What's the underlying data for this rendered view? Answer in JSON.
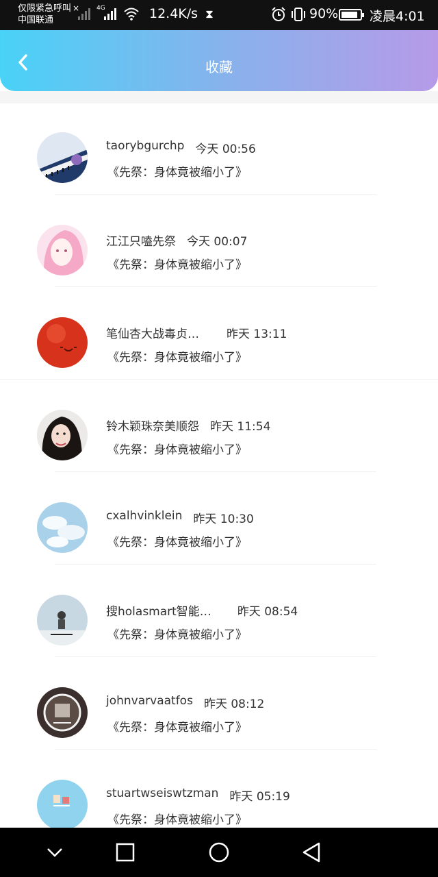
{
  "status_bar": {
    "line1": "仅限紧急呼叫",
    "carrier_x": "×",
    "line2": "中国联通",
    "network": "4G",
    "net_speed": "12.4K/s",
    "battery_percent": "90%",
    "battery_level": 0.9,
    "time": "凌晨4:01"
  },
  "header": {
    "title": "收藏",
    "colors": {
      "start": "#49d2f7",
      "end": "#b69ae8"
    }
  },
  "favorites": [
    {
      "name": "taorybgurchp",
      "time": "今天  00:56",
      "work": "《先祭：身体竟被缩小了》",
      "avatar": "piano-photo"
    },
    {
      "name": "江江只嗑先祭",
      "time": "今天  00:07",
      "work": "《先祭：身体竟被缩小了》",
      "avatar": "anime-girl-pink"
    },
    {
      "name": "笔仙杏大战毒贞…",
      "time": "昨天  13:11",
      "work": "《先祭：身体竟被缩小了》",
      "avatar": "red-tomato-face"
    },
    {
      "name": "铃木颖珠奈美顺怨",
      "time": "昨天  11:54",
      "work": "《先祭：身体竟被缩小了》",
      "avatar": "woman-portrait"
    },
    {
      "name": "cxalhvinklein",
      "time": "昨天  10:30",
      "work": "《先祭：身体竟被缩小了》",
      "avatar": "blue-sky-clouds"
    },
    {
      "name": "搜holasmart智能…",
      "time": "昨天  08:54",
      "work": "《先祭：身体竟被缩小了》",
      "avatar": "person-outdoor"
    },
    {
      "name": "johnvarvaatfos",
      "time": "昨天  08:12",
      "work": "《先祭：身体竟被缩小了》",
      "avatar": "dark-circle-logo"
    },
    {
      "name": "stuartwseiswtzman",
      "time": "昨天  05:19",
      "work": "《先祭：身体竟被缩小了》",
      "avatar": "cartoon-light-blue"
    }
  ],
  "nav": {
    "icons": [
      "chevron-down-icon",
      "recent-apps-icon",
      "home-icon",
      "back-icon"
    ]
  }
}
